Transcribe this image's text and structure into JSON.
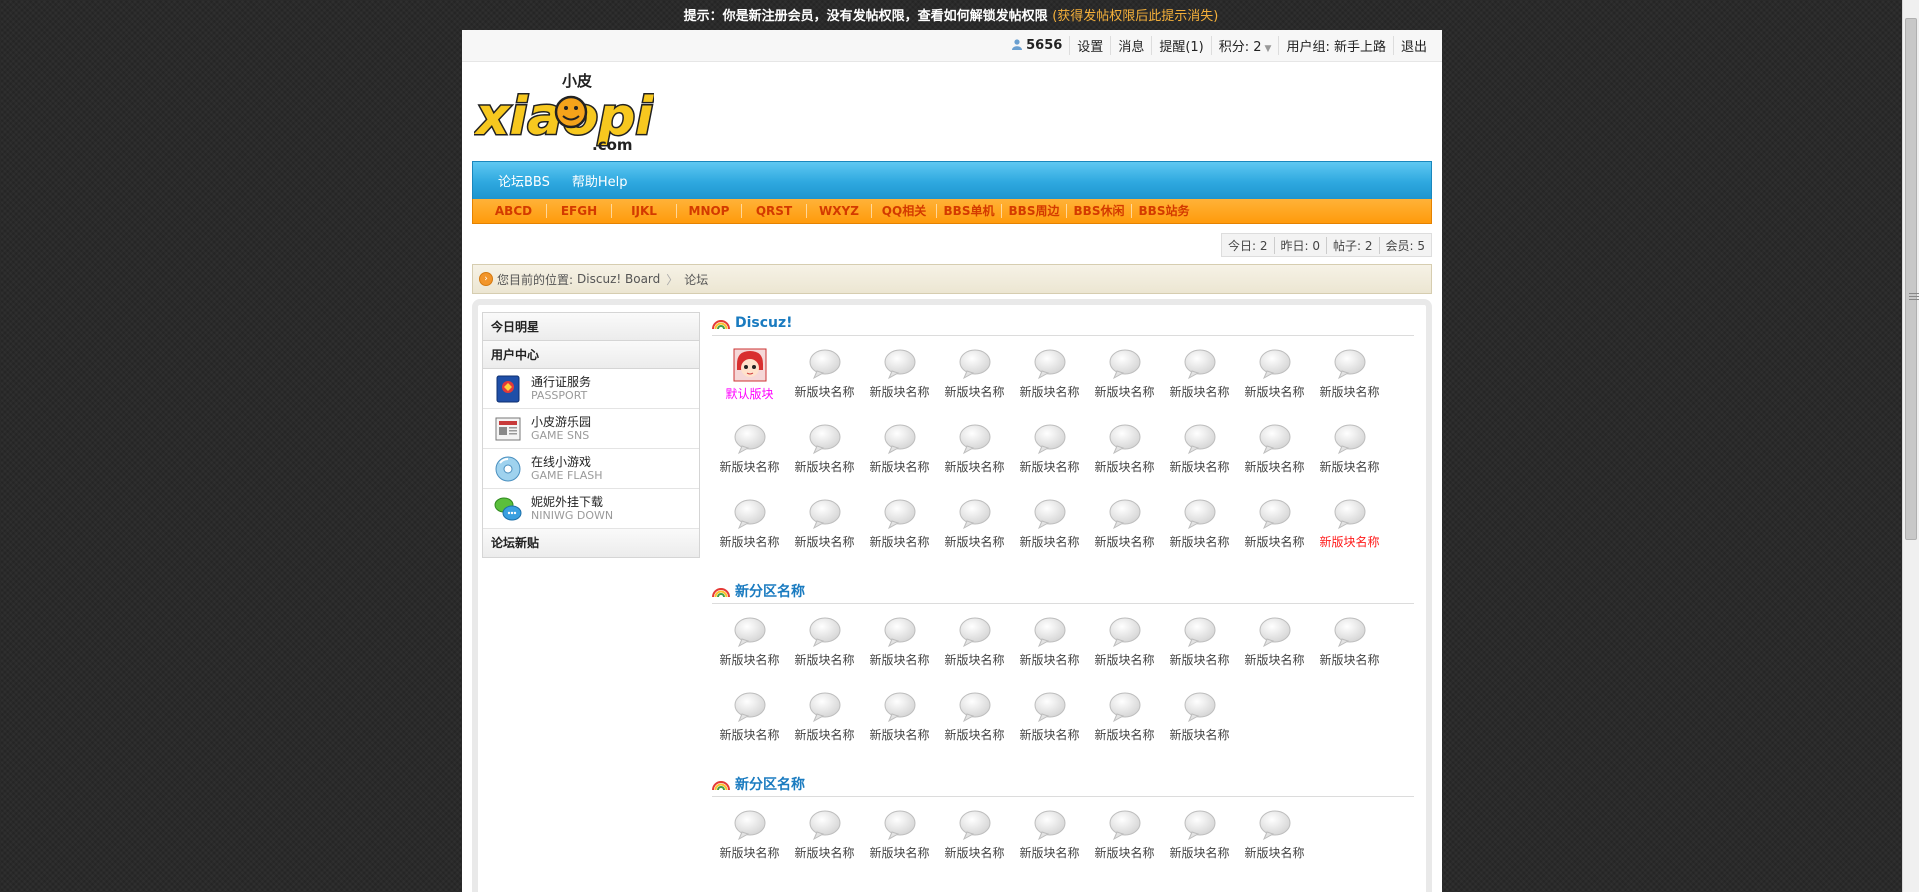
{
  "notice": {
    "text": "提示：你是新注册会员，没有发帖权限，查看如何解锁发帖权限",
    "hint": "(获得发帖权限后此提示消失)"
  },
  "userbar": {
    "username": "5656",
    "settings": "设置",
    "messages": "消息",
    "reminder": "提醒(1)",
    "points": "积分: 2",
    "usergroup": "用户组: 新手上路",
    "logout": "退出"
  },
  "logo": {
    "text": "xiaopi",
    "cn": "小皮",
    "com": ".com"
  },
  "mainnav": [
    "论坛BBS",
    "帮助Help"
  ],
  "subnav": [
    "ABCD",
    "EFGH",
    "IJKL",
    "MNOP",
    "QRST",
    "WXYZ",
    "QQ相关",
    "BBS单机",
    "BBS周边",
    "BBS休闲",
    "BBS站务"
  ],
  "stats": [
    "今日: 2",
    "昨日: 0",
    "帖子: 2",
    "会员: 5"
  ],
  "breadcrumb": {
    "prefix": "您目前的位置:",
    "board": "Discuz! Board",
    "current": "论坛"
  },
  "sidebar": {
    "star": "今日明星",
    "usercenter": "用户中心",
    "items": [
      {
        "title": "通行证服务",
        "sub": "PASSPORT",
        "icon": "passport-icon"
      },
      {
        "title": "小皮游乐园",
        "sub": "GAME SNS",
        "icon": "newspaper-icon"
      },
      {
        "title": "在线小游戏",
        "sub": "GAME FLASH",
        "icon": "disc-icon"
      },
      {
        "title": "妮妮外挂下载",
        "sub": "NINIWG DOWN",
        "icon": "chat-icon"
      }
    ],
    "newposts": "论坛新贴"
  },
  "categories": [
    {
      "name": "Discuz!",
      "forums": [
        {
          "name": "默认版块",
          "style": "mag",
          "icon": "avatar-icon"
        },
        {
          "name": "新版块名称"
        },
        {
          "name": "新版块名称"
        },
        {
          "name": "新版块名称"
        },
        {
          "name": "新版块名称"
        },
        {
          "name": "新版块名称"
        },
        {
          "name": "新版块名称"
        },
        {
          "name": "新版块名称"
        },
        {
          "name": "新版块名称"
        },
        {
          "name": "新版块名称"
        },
        {
          "name": "新版块名称"
        },
        {
          "name": "新版块名称"
        },
        {
          "name": "新版块名称"
        },
        {
          "name": "新版块名称"
        },
        {
          "name": "新版块名称"
        },
        {
          "name": "新版块名称"
        },
        {
          "name": "新版块名称"
        },
        {
          "name": "新版块名称"
        },
        {
          "name": "新版块名称"
        },
        {
          "name": "新版块名称"
        },
        {
          "name": "新版块名称"
        },
        {
          "name": "新版块名称"
        },
        {
          "name": "新版块名称"
        },
        {
          "name": "新版块名称"
        },
        {
          "name": "新版块名称"
        },
        {
          "name": "新版块名称"
        },
        {
          "name": "新版块名称",
          "style": "red"
        }
      ]
    },
    {
      "name": "新分区名称",
      "forums": [
        {
          "name": "新版块名称"
        },
        {
          "name": "新版块名称"
        },
        {
          "name": "新版块名称"
        },
        {
          "name": "新版块名称"
        },
        {
          "name": "新版块名称"
        },
        {
          "name": "新版块名称"
        },
        {
          "name": "新版块名称"
        },
        {
          "name": "新版块名称"
        },
        {
          "name": "新版块名称"
        },
        {
          "name": "新版块名称"
        },
        {
          "name": "新版块名称"
        },
        {
          "name": "新版块名称"
        },
        {
          "name": "新版块名称"
        },
        {
          "name": "新版块名称"
        },
        {
          "name": "新版块名称"
        },
        {
          "name": "新版块名称"
        }
      ]
    },
    {
      "name": "新分区名称",
      "forums": [
        {
          "name": "新版块名称"
        },
        {
          "name": "新版块名称"
        },
        {
          "name": "新版块名称"
        },
        {
          "name": "新版块名称"
        },
        {
          "name": "新版块名称"
        },
        {
          "name": "新版块名称"
        },
        {
          "name": "新版块名称"
        },
        {
          "name": "新版块名称"
        }
      ]
    }
  ],
  "colors": {
    "nav_blue": "#2ea8df",
    "subnav_orange": "#ff9b0c",
    "subnav_text": "#d33a00",
    "category_title": "#1a7bc0",
    "default_forum": "#ff00ff",
    "highlight_forum": "#ff1a1a"
  }
}
